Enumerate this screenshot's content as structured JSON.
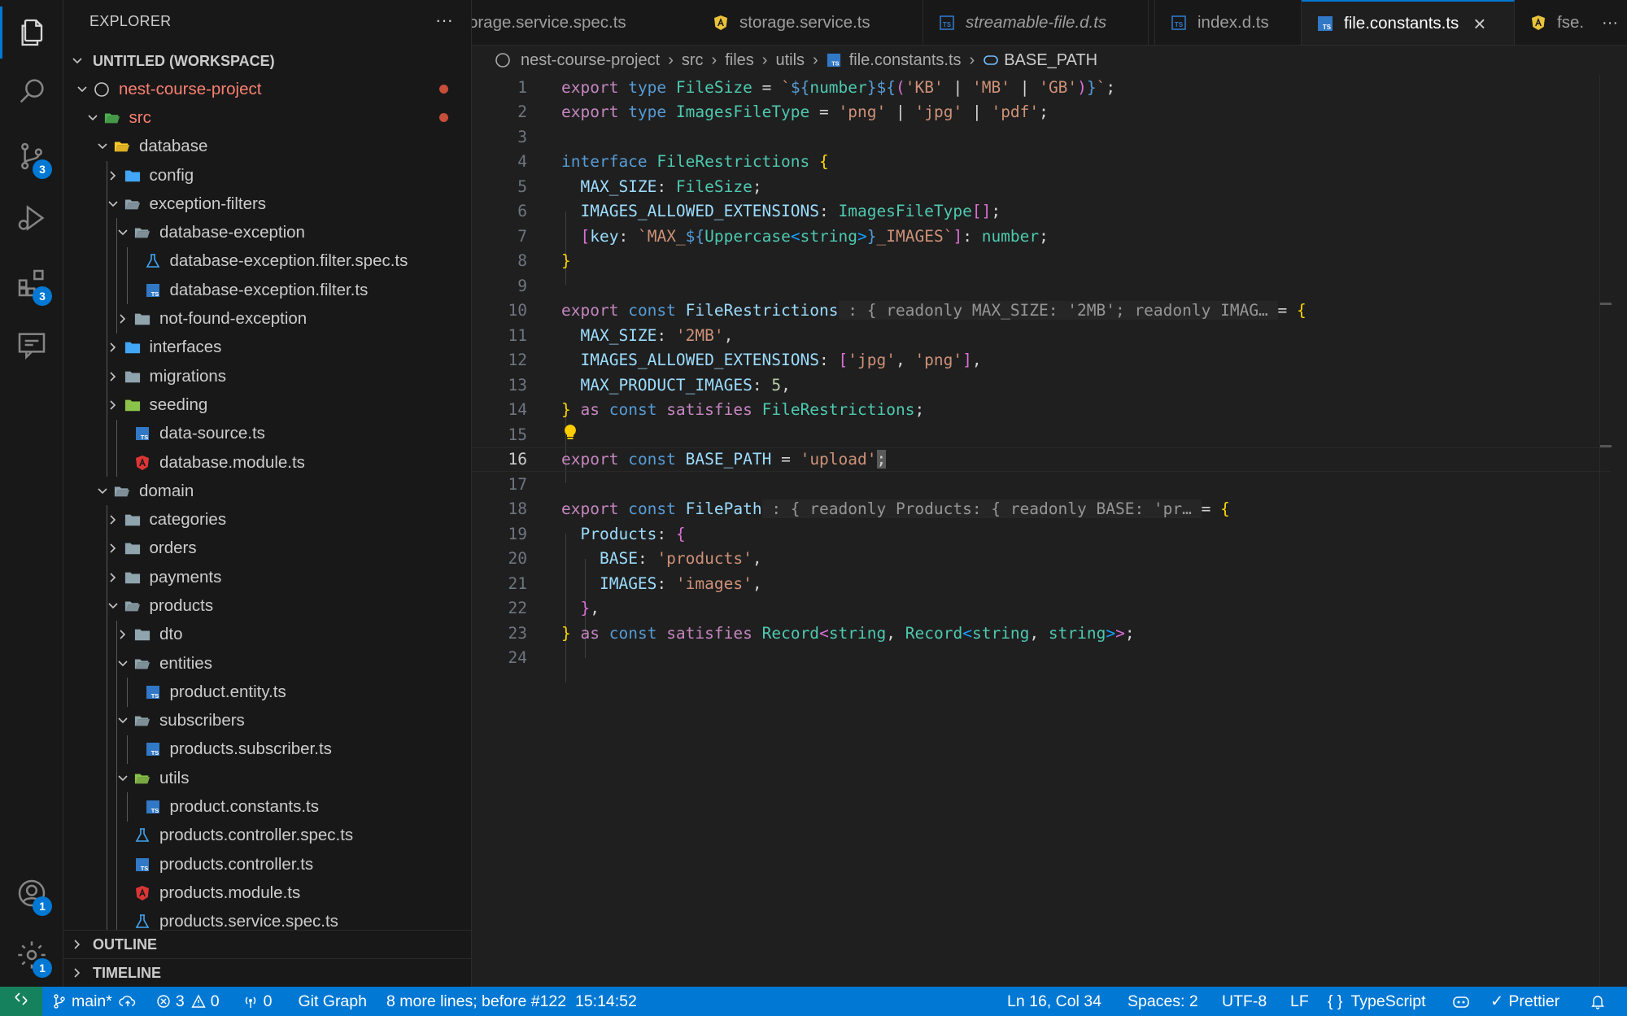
{
  "activity_bar": {
    "items": [
      {
        "icon": "files-icon",
        "badge": ""
      },
      {
        "icon": "search-icon",
        "badge": ""
      },
      {
        "icon": "source-control-icon",
        "badge": "3"
      },
      {
        "icon": "run-debug-icon",
        "badge": ""
      },
      {
        "icon": "extensions-icon",
        "badge": "3"
      },
      {
        "icon": "comments-icon",
        "badge": ""
      }
    ],
    "accounts_badge": "1",
    "settings_badge": "1"
  },
  "sidebar": {
    "title": "EXPLORER",
    "more": "···",
    "workspace": "UNTITLED (WORKSPACE)",
    "tree": [
      {
        "label": "nest-course-project",
        "depth": 1,
        "type": "root",
        "open": true,
        "modified": true
      },
      {
        "label": "src",
        "depth": 2,
        "type": "folder-src",
        "open": true,
        "modified": true
      },
      {
        "label": "database",
        "depth": 3,
        "type": "folder-db",
        "open": true
      },
      {
        "label": "config",
        "depth": 4,
        "type": "folder-config",
        "open": false
      },
      {
        "label": "exception-filters",
        "depth": 4,
        "type": "folder",
        "open": true
      },
      {
        "label": "database-exception",
        "depth": 5,
        "type": "folder",
        "open": true
      },
      {
        "label": "database-exception.filter.spec.ts",
        "depth": 6,
        "type": "spec"
      },
      {
        "label": "database-exception.filter.ts",
        "depth": 6,
        "type": "ts"
      },
      {
        "label": "not-found-exception",
        "depth": 5,
        "type": "folder",
        "open": false
      },
      {
        "label": "interfaces",
        "depth": 4,
        "type": "folder-interfaces",
        "open": false
      },
      {
        "label": "migrations",
        "depth": 4,
        "type": "folder",
        "open": false
      },
      {
        "label": "seeding",
        "depth": 4,
        "type": "folder-seed",
        "open": false
      },
      {
        "label": "data-source.ts",
        "depth": 5,
        "type": "ts"
      },
      {
        "label": "database.module.ts",
        "depth": 5,
        "type": "angular"
      },
      {
        "label": "domain",
        "depth": 3,
        "type": "folder",
        "open": true
      },
      {
        "label": "categories",
        "depth": 4,
        "type": "folder",
        "open": false
      },
      {
        "label": "orders",
        "depth": 4,
        "type": "folder",
        "open": false
      },
      {
        "label": "payments",
        "depth": 4,
        "type": "folder",
        "open": false
      },
      {
        "label": "products",
        "depth": 4,
        "type": "folder",
        "open": true
      },
      {
        "label": "dto",
        "depth": 5,
        "type": "folder",
        "open": false
      },
      {
        "label": "entities",
        "depth": 5,
        "type": "folder",
        "open": true
      },
      {
        "label": "product.entity.ts",
        "depth": 6,
        "type": "ts"
      },
      {
        "label": "subscribers",
        "depth": 5,
        "type": "folder",
        "open": true
      },
      {
        "label": "products.subscriber.ts",
        "depth": 6,
        "type": "ts"
      },
      {
        "label": "utils",
        "depth": 5,
        "type": "folder-utils",
        "open": true
      },
      {
        "label": "product.constants.ts",
        "depth": 6,
        "type": "ts"
      },
      {
        "label": "products.controller.spec.ts",
        "depth": 5,
        "type": "spec"
      },
      {
        "label": "products.controller.ts",
        "depth": 5,
        "type": "ts"
      },
      {
        "label": "products.module.ts",
        "depth": 5,
        "type": "angular"
      },
      {
        "label": "products.service.spec.ts",
        "depth": 5,
        "type": "spec"
      }
    ],
    "outline": "OUTLINE",
    "timeline": "TIMELINE"
  },
  "tabs": [
    {
      "label": "storage.service.spec.ts",
      "type": "none",
      "italic": false
    },
    {
      "label": "storage.service.ts",
      "type": "angular-y",
      "italic": false
    },
    {
      "label": "streamable-file.d.ts",
      "type": "ts",
      "italic": true
    },
    {
      "label": "index.d.ts",
      "type": "ts",
      "italic": false
    },
    {
      "label": "file.constants.ts",
      "type": "ts",
      "italic": false,
      "active": true
    },
    {
      "label": "fse.",
      "type": "angular-y",
      "italic": false
    }
  ],
  "tab_close": "×",
  "tab_more": "···",
  "breadcrumb": [
    "nest-course-project",
    "src",
    "files",
    "utils",
    "file.constants.ts",
    "BASE_PATH"
  ],
  "editor": {
    "current_line": 16,
    "line_numbers": [
      "1",
      "2",
      "3",
      "4",
      "5",
      "6",
      "7",
      "8",
      "9",
      "10",
      "11",
      "12",
      "13",
      "14",
      "15",
      "16",
      "17",
      "18",
      "19",
      "20",
      "21",
      "22",
      "23",
      "24"
    ]
  },
  "status": {
    "branch": "main*",
    "errors": "3",
    "warnings": "0",
    "ports": "0",
    "git_graph": "Git Graph",
    "blame": "8 more lines; before #122  15:14:52",
    "position": "Ln 16, Col 34",
    "spaces": "Spaces: 2",
    "encoding": "UTF-8",
    "eol": "LF",
    "language": "TypeScript",
    "prettier": "Prettier"
  },
  "colors": {
    "accent": "#0078d4",
    "remote": "#16825d",
    "modified": "#c74e39"
  }
}
